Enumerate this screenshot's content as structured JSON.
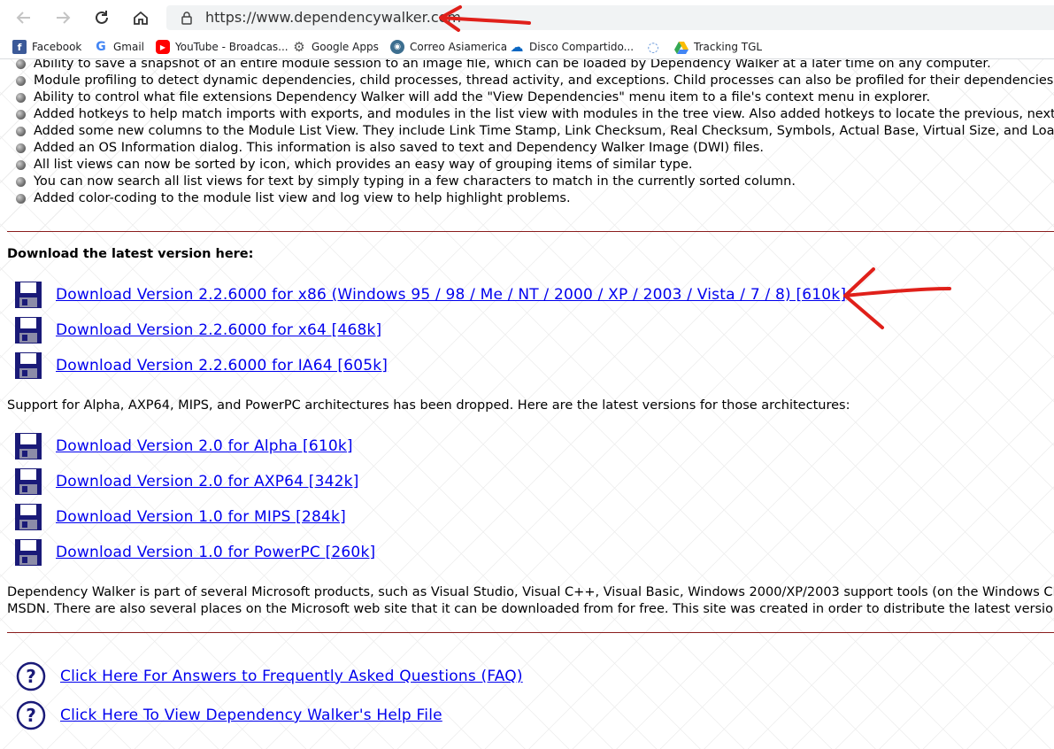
{
  "browser": {
    "url": "https://www.dependencywalker.com",
    "bookmarks": [
      {
        "label": "Facebook",
        "icon": "facebook-icon",
        "color": "#3b5998"
      },
      {
        "label": "Gmail",
        "icon": "google-icon",
        "color": "#4285f4"
      },
      {
        "label": "YouTube - Broadcas...",
        "icon": "youtube-icon",
        "color": "#ff0000"
      },
      {
        "label": "Google Apps",
        "icon": "gear-icon",
        "color": "#555555"
      },
      {
        "label": "Correo Asiamerica",
        "icon": "globe-icon",
        "color": "#3c6e8f"
      },
      {
        "label": "Disco Compartido...",
        "icon": "cloud-icon",
        "color": "#0a66c2"
      },
      {
        "label": "",
        "icon": "globe-icon",
        "color": "#5b8fd6"
      },
      {
        "label": "Tracking TGL",
        "icon": "drive-icon",
        "color": "#34a853"
      }
    ]
  },
  "features": [
    "Ability to save a snapshot of an entire module session to an image file, which can be loaded by Dependency Walker at a later time on any computer.",
    "Module profiling to detect dynamic dependencies, child processes, thread activity, and exceptions. Child processes can also be profiled for their dependencies.",
    "Ability to control what file extensions Dependency Walker will add the \"View Dependencies\" menu item to a file's context menu in explorer.",
    "Added hotkeys to help match imports with exports, and modules in the list view with modules in the tree view. Also added hotkeys to locate the previous, next,",
    "Added some new columns to the Module List View. They include Link Time Stamp, Link Checksum, Real Checksum, Symbols, Actual Base, Virtual Size, and Load O",
    "Added an OS Information dialog. This information is also saved to text and Dependency Walker Image (DWI) files.",
    "All list views can now be sorted by icon, which provides an easy way of grouping items of similar type.",
    "You can now search all list views for text by simply typing in a few characters to match in the currently sorted column.",
    "Added color-coding to the module list view and log view to help highlight problems."
  ],
  "download_heading": "Download the latest version here:",
  "downloads_latest": [
    "Download Version 2.2.6000 for x86 (Windows 95 / 98 / Me / NT / 2000 / XP / 2003 / Vista / 7 / 8) [610k]",
    "Download Version 2.2.6000 for x64 [468k]",
    "Download Version 2.2.6000 for IA64 [605k]"
  ],
  "legacy_note": "Support for Alpha, AXP64, MIPS, and PowerPC architectures has been dropped.  Here are the latest versions for those architectures:",
  "downloads_legacy": [
    "Download Version 2.0 for Alpha [610k]",
    "Download Version 2.0 for AXP64 [342k]",
    "Download Version 1.0 for MIPS [284k]",
    "Download Version 1.0 for PowerPC [260k]"
  ],
  "about_lines": [
    "Dependency Walker is part of several Microsoft products, such as Visual Studio, Visual C++, Visual Basic, Windows 2000/XP/2003 support tools (on the Windows CD),",
    "MSDN.  There are also several places on the Microsoft web site that it can be downloaded from for free.  This site was created in order to distribute the latest versio"
  ],
  "help_links": [
    "Click Here For Answers to Frequently Asked Questions (FAQ)",
    "Click Here To View Dependency Walker's Help File"
  ],
  "colors": {
    "link": "#0000ee",
    "rule": "#8b1d1d",
    "floppy": "#1a1a78",
    "annotation": "#e0201a"
  }
}
